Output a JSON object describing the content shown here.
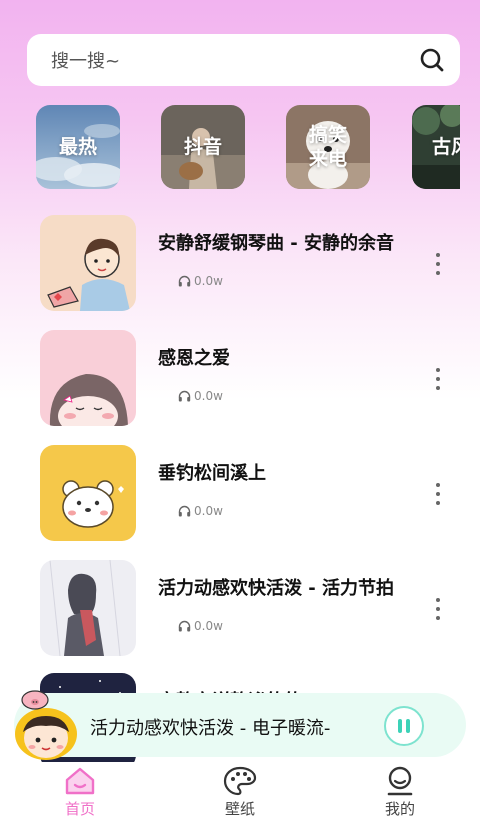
{
  "search": {
    "placeholder": "搜一搜~",
    "icon": "search-icon"
  },
  "categories": [
    {
      "label": "最热",
      "bg": "#7fa3c4"
    },
    {
      "label": "抖音",
      "bg": "#7a6e62"
    },
    {
      "label": "搞笑\n来电",
      "bg": "#8e7867"
    },
    {
      "label": "古风",
      "bg": "#3e5540"
    }
  ],
  "songs": [
    {
      "title": "安静舒缓钢琴曲 - 安静的余音",
      "plays": "0.0w"
    },
    {
      "title": "感恩之爱",
      "plays": "0.0w"
    },
    {
      "title": "垂钓松间溪上",
      "plays": "0.0w"
    },
    {
      "title": "活力动感欢快活泼 - 活力节拍",
      "plays": "0.0w"
    },
    {
      "title": "宁静安详静谧的的",
      "plays": ""
    }
  ],
  "player": {
    "title": "活力动感欢快活泼 - 电子暖流-",
    "state_icon": "pause-icon"
  },
  "tabs": [
    {
      "label": "首页",
      "icon": "home-icon",
      "active": true
    },
    {
      "label": "壁纸",
      "icon": "palette-icon",
      "active": false
    },
    {
      "label": "我的",
      "icon": "profile-icon",
      "active": false
    }
  ],
  "colors": {
    "accent": "#f070c8",
    "player_bg": "#e9fbf4",
    "pause_accent": "#3dd2b8"
  }
}
